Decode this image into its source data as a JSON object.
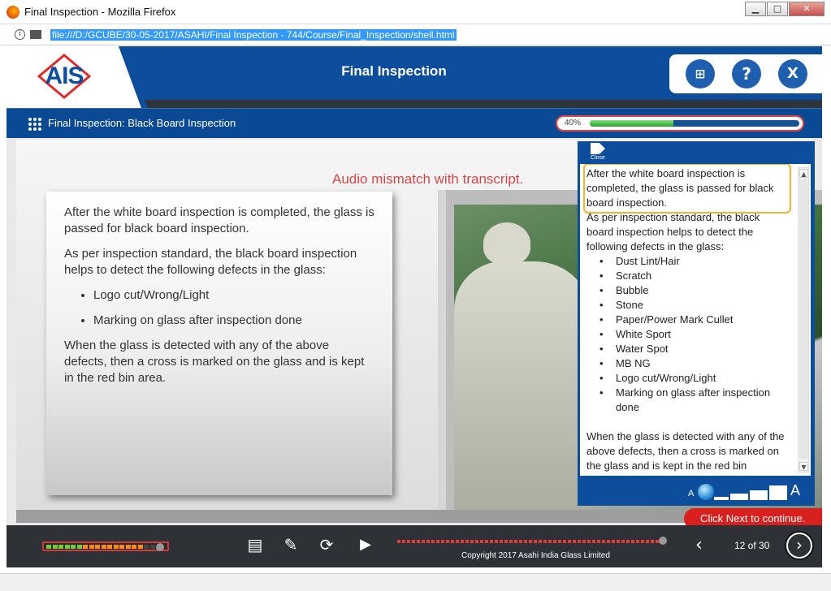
{
  "window": {
    "title": "Final Inspection - Mozilla Firefox",
    "url": "file:///D:/GCUBE/30-05-2017/ASAHI/Final Inspection - 744/Course/Final_Inspection/shell.html",
    "minimize": "▁",
    "maximize": "□",
    "close": "✕"
  },
  "header": {
    "logo_text": "AIS",
    "title": "Final Inspection",
    "map_icon": "⊞",
    "help_icon": "?",
    "exit_icon": "X"
  },
  "subheader": {
    "title": "Final Inspection: Black Board Inspection",
    "progress_label": "40%",
    "progress_value": 0.4
  },
  "annotation": "Audio mismatch with transcript.",
  "content": {
    "para1": "After the white board inspection is completed, the glass is passed for black board inspection.",
    "para2": "As per inspection standard, the black board inspection helps to detect the following defects in the glass:",
    "bullets": [
      "Logo cut/Wrong/Light",
      "Marking on glass after inspection done"
    ],
    "para3": "When the glass is detected with any of the above defects, then a cross is marked on the glass and is kept in the red bin area."
  },
  "transcript": {
    "close_label": "Close",
    "highlight": "After the white board inspection is completed, the glass is passed for black board inspection.",
    "intro": "As per inspection standard, the black board inspection helps to detect the following defects in the glass:",
    "defects": [
      "Dust Lint/Hair",
      "Scratch",
      "Bubble",
      "Stone",
      "Paper/Power Mark Cullet",
      "White Sport",
      "Water Spot",
      "MB NG",
      "Logo cut/Wrong/Light",
      "Marking on glass after inspection done"
    ],
    "outro": "When the glass is detected with any of the above defects, then a cross is marked on the glass and is kept in the red bin",
    "font_small": "A",
    "font_large": "A"
  },
  "next_tip": "Click Next to continue.",
  "footer": {
    "copyright": "Copyright 2017 Asahi India Glass Limited",
    "page": "12 of 30",
    "prev_icon": "‹",
    "next_icon": "›",
    "transcript_icon": "▤",
    "notes_icon": "✎",
    "replay_icon": "⟳",
    "play_icon": "▶",
    "volume_level": 0.9,
    "seek_position": 0.98
  },
  "colors": {
    "brand_blue": "#0c4e9c",
    "accent_red": "#d8211f",
    "highlight_orange": "#f2b233",
    "progress_green": "#2da22d"
  }
}
